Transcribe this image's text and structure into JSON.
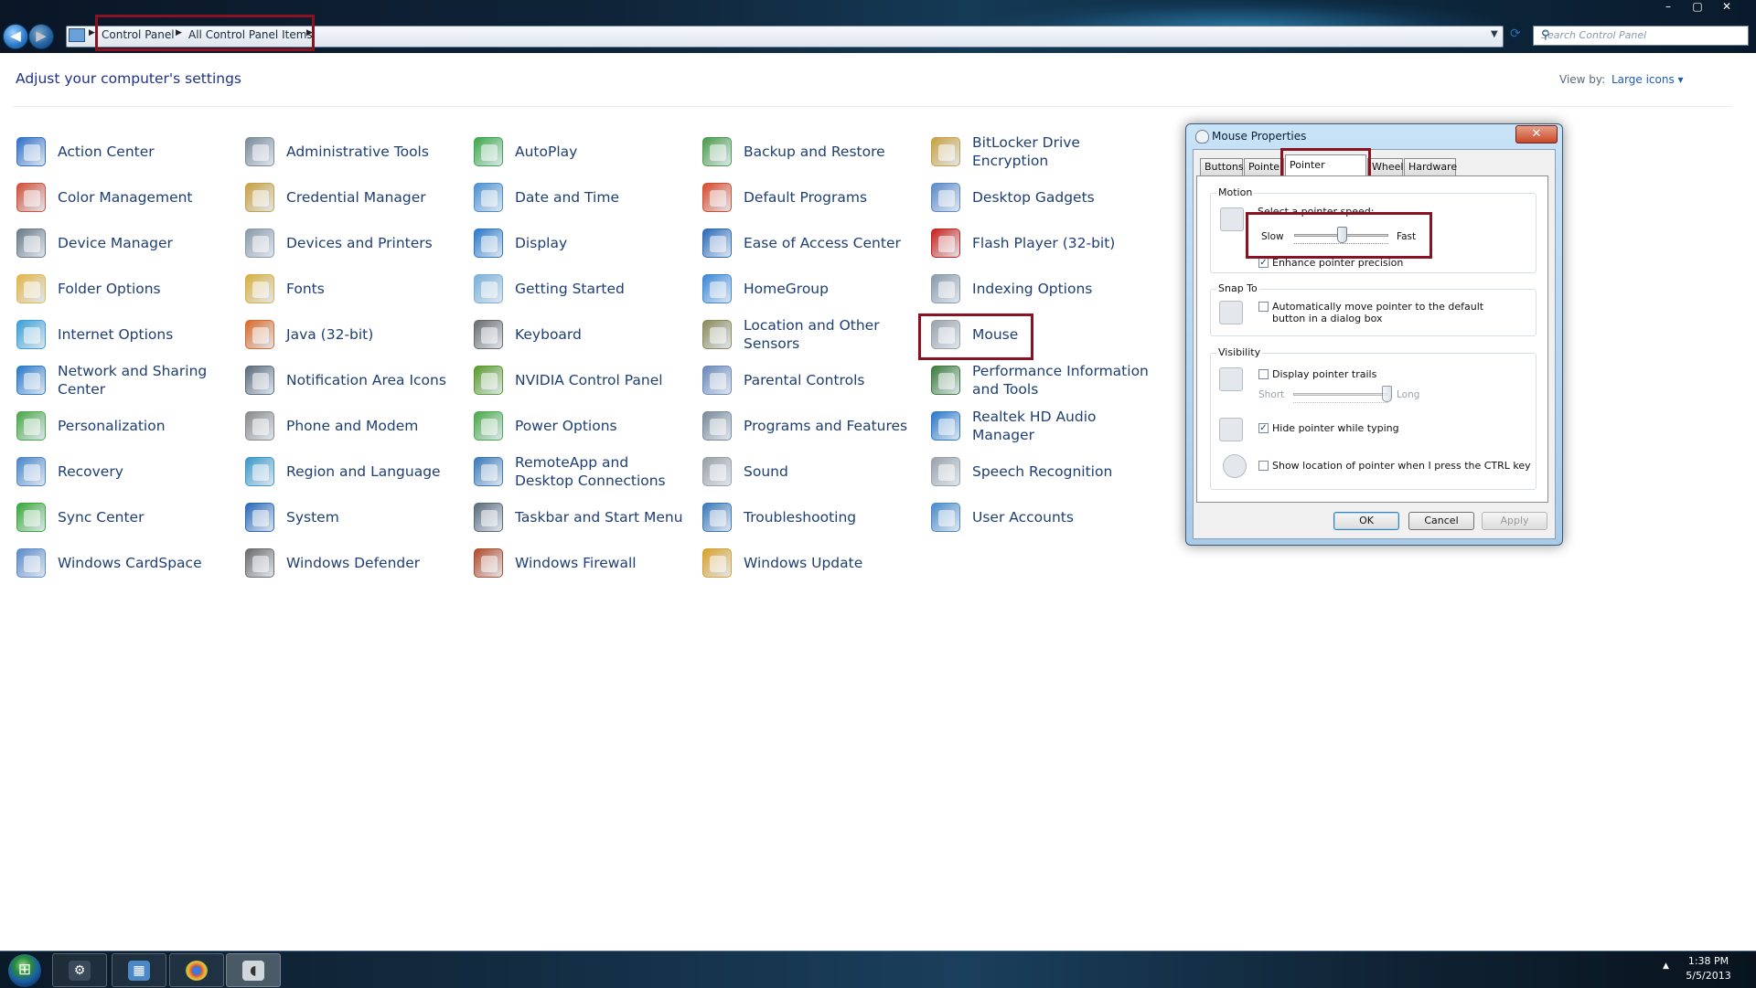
{
  "window": {
    "minimize": "–",
    "maximize": "▢",
    "close": "✕"
  },
  "nav": {
    "back": "◀",
    "forward": "▶",
    "breadcrumb": [
      "Control Panel",
      "All Control Panel Items"
    ],
    "search_placeholder": "Search Control Panel"
  },
  "content": {
    "heading": "Adjust your computer's settings",
    "view_by_label": "View by:",
    "view_by_value": "Large icons ▾"
  },
  "items": [
    {
      "label": "Action Center",
      "icon": "flag-icon",
      "color": "#2f6fc8"
    },
    {
      "label": "Color Management",
      "icon": "color-management-icon",
      "color": "#d0503a"
    },
    {
      "label": "Device Manager",
      "icon": "device-manager-icon",
      "color": "#6a7a88"
    },
    {
      "label": "Folder Options",
      "icon": "folder-icon",
      "color": "#e2b64a"
    },
    {
      "label": "Internet Options",
      "icon": "globe-icon",
      "color": "#3aa0d8"
    },
    {
      "label": "Network and Sharing Center",
      "icon": "network-icon",
      "color": "#2a78c8"
    },
    {
      "label": "Personalization",
      "icon": "personalization-icon",
      "color": "#4aa84a"
    },
    {
      "label": "Recovery",
      "icon": "recovery-icon",
      "color": "#4a86c8"
    },
    {
      "label": "Sync Center",
      "icon": "sync-icon",
      "color": "#3aa83a"
    },
    {
      "label": "Windows CardSpace",
      "icon": "cardspace-icon",
      "color": "#5a8ac8"
    },
    {
      "label": "Administrative Tools",
      "icon": "admin-tools-icon",
      "color": "#7a8a9a"
    },
    {
      "label": "Credential Manager",
      "icon": "credential-icon",
      "color": "#c8a040"
    },
    {
      "label": "Devices and Printers",
      "icon": "printer-icon",
      "color": "#8a9aaa"
    },
    {
      "label": "Fonts",
      "icon": "fonts-icon",
      "color": "#d8b040"
    },
    {
      "label": "Java (32-bit)",
      "icon": "java-icon",
      "color": "#d86a2a"
    },
    {
      "label": "Notification Area Icons",
      "icon": "notification-icon",
      "color": "#5a6a7a"
    },
    {
      "label": "Phone and Modem",
      "icon": "phone-icon",
      "color": "#8a8a8a"
    },
    {
      "label": "Region and Language",
      "icon": "region-icon",
      "color": "#3a98c8"
    },
    {
      "label": "System",
      "icon": "system-icon",
      "color": "#2a68b8"
    },
    {
      "label": "Windows Defender",
      "icon": "defender-icon",
      "color": "#6a6a6a"
    },
    {
      "label": "AutoPlay",
      "icon": "autoplay-icon",
      "color": "#3aa84a"
    },
    {
      "label": "Date and Time",
      "icon": "calendar-icon",
      "color": "#4a90d0"
    },
    {
      "label": "Display",
      "icon": "display-icon",
      "color": "#2a78c8"
    },
    {
      "label": "Getting Started",
      "icon": "getting-started-icon",
      "color": "#7ab0d8"
    },
    {
      "label": "Keyboard",
      "icon": "keyboard-icon",
      "color": "#6a6a6a"
    },
    {
      "label": "NVIDIA Control Panel",
      "icon": "nvidia-icon",
      "color": "#5a9a2a"
    },
    {
      "label": "Power Options",
      "icon": "power-icon",
      "color": "#4aa84a"
    },
    {
      "label": "RemoteApp and Desktop Connections",
      "icon": "remoteapp-icon",
      "color": "#3a78b8"
    },
    {
      "label": "Taskbar and Start Menu",
      "icon": "taskbar-icon",
      "color": "#5a6a7a"
    },
    {
      "label": "Windows Firewall",
      "icon": "firewall-icon",
      "color": "#b04a2a"
    },
    {
      "label": "Backup and Restore",
      "icon": "backup-icon",
      "color": "#4a9a4a"
    },
    {
      "label": "Default Programs",
      "icon": "default-programs-icon",
      "color": "#d84a2a"
    },
    {
      "label": "Ease of Access Center",
      "icon": "ease-of-access-icon",
      "color": "#2a68b8"
    },
    {
      "label": "HomeGroup",
      "icon": "homegroup-icon",
      "color": "#3a88d8"
    },
    {
      "label": "Location and Other Sensors",
      "icon": "sensors-icon",
      "color": "#8a8a5a"
    },
    {
      "label": "Parental Controls",
      "icon": "parental-icon",
      "color": "#6a88b8"
    },
    {
      "label": "Programs and Features",
      "icon": "programs-icon",
      "color": "#7a8a9a"
    },
    {
      "label": "Sound",
      "icon": "sound-icon",
      "color": "#9aa0a8"
    },
    {
      "label": "Troubleshooting",
      "icon": "troubleshooting-icon",
      "color": "#3a78b8"
    },
    {
      "label": "Windows Update",
      "icon": "windows-update-icon",
      "color": "#d8a02a"
    },
    {
      "label": "BitLocker Drive Encryption",
      "icon": "bitlocker-icon",
      "color": "#c8a040"
    },
    {
      "label": "Desktop Gadgets",
      "icon": "gadgets-icon",
      "color": "#5a8ac8"
    },
    {
      "label": "Flash Player (32-bit)",
      "icon": "flash-icon",
      "color": "#c8201a"
    },
    {
      "label": "Indexing Options",
      "icon": "indexing-icon",
      "color": "#8a9aaa"
    },
    {
      "label": "Mouse",
      "icon": "mouse-icon",
      "color": "#9aa2aa"
    },
    {
      "label": "Performance Information and Tools",
      "icon": "performance-icon",
      "color": "#3a7a3a"
    },
    {
      "label": "Realtek HD Audio Manager",
      "icon": "realtek-icon",
      "color": "#2a78c8"
    },
    {
      "label": "Speech Recognition",
      "icon": "microphone-icon",
      "color": "#9aa2aa"
    },
    {
      "label": "User Accounts",
      "icon": "user-accounts-icon",
      "color": "#4a8ac8"
    }
  ],
  "dialog": {
    "title": "Mouse Properties",
    "close": "✕",
    "tabs": [
      "Buttons",
      "Pointers",
      "Pointer Options",
      "Wheel",
      "Hardware"
    ],
    "active_tab": "Pointer Options",
    "motion": {
      "group": "Motion",
      "select_speed": "Select a pointer speed:",
      "slow": "Slow",
      "fast": "Fast",
      "speed_level": 0.5,
      "enhance_precision": "Enhance pointer precision",
      "enhance_checked": true
    },
    "snap": {
      "group": "Snap To",
      "option": "Automatically move pointer to the default button in a dialog box",
      "checked": false
    },
    "visibility": {
      "group": "Visibility",
      "trails": "Display pointer trails",
      "trails_checked": false,
      "short": "Short",
      "long": "Long",
      "trail_level": 1.0,
      "hide_typing": "Hide pointer while typing",
      "hide_checked": true,
      "show_ctrl": "Show location of pointer when I press the CTRL key",
      "show_checked": false
    },
    "buttons": {
      "ok": "OK",
      "cancel": "Cancel",
      "apply": "Apply"
    }
  },
  "taskbar": {
    "start": "⊞",
    "time": "1:38 PM",
    "date": "5/5/2013",
    "tray_arrow": "▲"
  },
  "colors": {
    "highlight_box": "#8a1221",
    "link_text": "#1e3f73",
    "heading": "#1e3287"
  }
}
